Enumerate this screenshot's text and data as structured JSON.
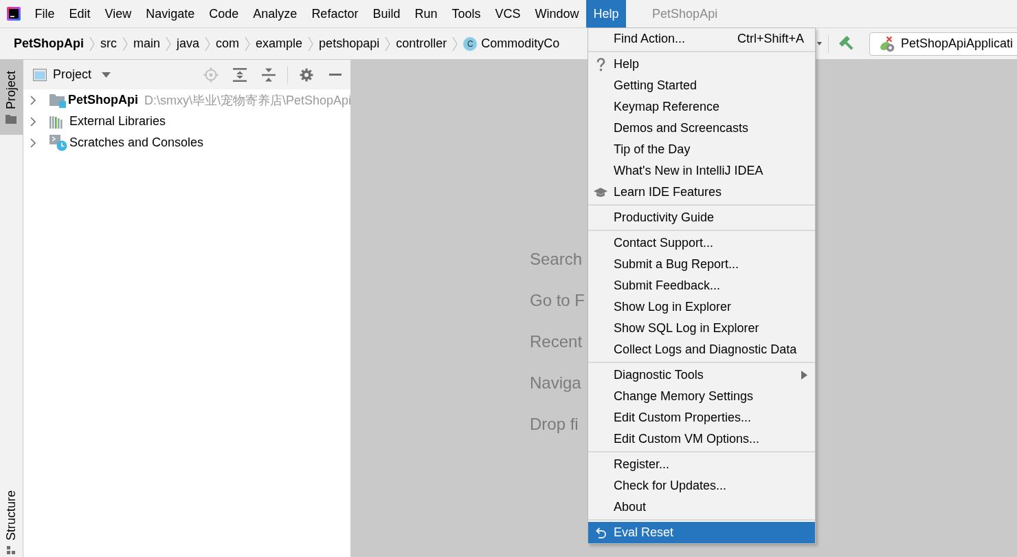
{
  "window": {
    "title": "PetShopApi"
  },
  "menu_bar": {
    "items": [
      {
        "label": "File",
        "selected": false
      },
      {
        "label": "Edit",
        "selected": false
      },
      {
        "label": "View",
        "selected": false
      },
      {
        "label": "Navigate",
        "selected": false
      },
      {
        "label": "Code",
        "selected": false
      },
      {
        "label": "Analyze",
        "selected": false
      },
      {
        "label": "Refactor",
        "selected": false
      },
      {
        "label": "Build",
        "selected": false
      },
      {
        "label": "Run",
        "selected": false
      },
      {
        "label": "Tools",
        "selected": false
      },
      {
        "label": "VCS",
        "selected": false
      },
      {
        "label": "Window",
        "selected": false
      },
      {
        "label": "Help",
        "selected": true
      }
    ]
  },
  "navigation_bar": {
    "crumbs": [
      {
        "label": "PetShopApi",
        "kind": "project"
      },
      {
        "label": "src",
        "kind": "folder"
      },
      {
        "label": "main",
        "kind": "folder"
      },
      {
        "label": "java",
        "kind": "folder"
      },
      {
        "label": "com",
        "kind": "folder"
      },
      {
        "label": "example",
        "kind": "folder"
      },
      {
        "label": "petshopapi",
        "kind": "folder"
      },
      {
        "label": "controller",
        "kind": "folder"
      },
      {
        "label": "CommodityCo",
        "kind": "class",
        "badge": "C"
      }
    ],
    "run_configuration": {
      "label": "PetShopApiApplicati",
      "invalid": true
    }
  },
  "tool_window_bar": {
    "top": [
      {
        "label": "Project",
        "kind": "project",
        "selected": true
      }
    ],
    "bottom": [
      {
        "label": "Structure",
        "kind": "structure",
        "selected": false
      }
    ]
  },
  "project_panel": {
    "view": "Project",
    "tools": [
      {
        "kind": "locate",
        "disabled": true
      },
      {
        "kind": "expand_all",
        "disabled": false
      },
      {
        "kind": "collapse_all",
        "disabled": false
      },
      {
        "kind": "settings",
        "disabled": false
      },
      {
        "kind": "hide",
        "disabled": false
      }
    ],
    "tree": [
      {
        "label": "PetShopApi",
        "kind": "module",
        "path": "D:\\smxy\\毕业\\宠物寄养店\\PetShopApi",
        "expanded": false
      },
      {
        "label": "External Libraries",
        "kind": "libraries",
        "expanded": false
      },
      {
        "label": "Scratches and Consoles",
        "kind": "scratches",
        "expanded": false
      }
    ]
  },
  "editor": {
    "hints": [
      "Search",
      "Go to F",
      "Recent",
      "Naviga",
      "Drop fi"
    ]
  },
  "help_menu": {
    "sections": [
      {
        "items": [
          {
            "label": "Find Action...",
            "shortcut": "Ctrl+Shift+A",
            "kind": "action",
            "selected": false
          }
        ]
      },
      {
        "items": [
          {
            "label": "Help",
            "kind": "help",
            "selected": false
          },
          {
            "label": "Getting Started",
            "kind": "action",
            "selected": false
          },
          {
            "label": "Keymap Reference",
            "kind": "action",
            "selected": false
          },
          {
            "label": "Demos and Screencasts",
            "kind": "action",
            "selected": false
          },
          {
            "label": "Tip of the Day",
            "kind": "action",
            "selected": false
          },
          {
            "label": "What's New in IntelliJ IDEA",
            "kind": "action",
            "selected": false
          },
          {
            "label": "Learn IDE Features",
            "kind": "learn",
            "selected": false
          }
        ]
      },
      {
        "items": [
          {
            "label": "Productivity Guide",
            "kind": "action",
            "selected": false
          }
        ]
      },
      {
        "items": [
          {
            "label": "Contact Support...",
            "kind": "action",
            "selected": false
          },
          {
            "label": "Submit a Bug Report...",
            "kind": "action",
            "selected": false
          },
          {
            "label": "Submit Feedback...",
            "kind": "action",
            "selected": false
          },
          {
            "label": "Show Log in Explorer",
            "kind": "action",
            "selected": false
          },
          {
            "label": "Show SQL Log in Explorer",
            "kind": "action",
            "selected": false
          },
          {
            "label": "Collect Logs and Diagnostic Data",
            "kind": "action",
            "selected": false
          }
        ]
      },
      {
        "items": [
          {
            "label": "Diagnostic Tools",
            "kind": "submenu",
            "selected": false
          },
          {
            "label": "Change Memory Settings",
            "kind": "action",
            "selected": false
          },
          {
            "label": "Edit Custom Properties...",
            "kind": "action",
            "selected": false
          },
          {
            "label": "Edit Custom VM Options...",
            "kind": "action",
            "selected": false
          }
        ]
      },
      {
        "items": [
          {
            "label": "Register...",
            "kind": "action",
            "selected": false
          },
          {
            "label": "Check for Updates...",
            "kind": "action",
            "selected": false
          },
          {
            "label": "About",
            "kind": "action",
            "selected": false
          }
        ]
      },
      {
        "items": [
          {
            "label": "Eval Reset",
            "kind": "reset",
            "selected": true
          }
        ]
      }
    ]
  }
}
